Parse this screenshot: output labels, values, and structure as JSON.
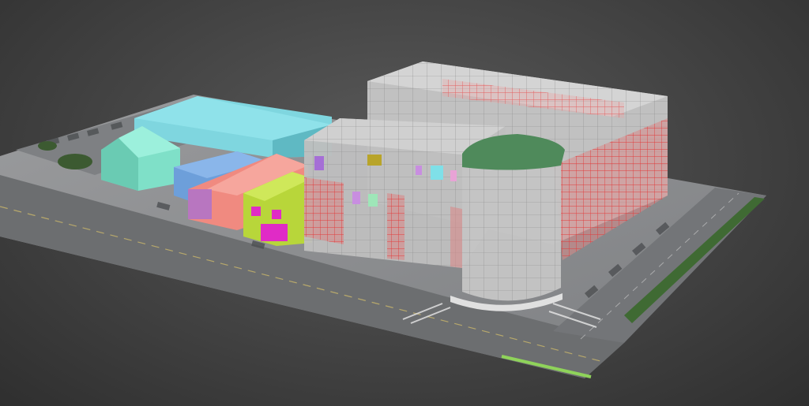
{
  "viewport": {
    "background": "#474747",
    "label": ""
  },
  "scene": {
    "ground": {
      "color": "#8e9092",
      "road_color": "#6c6e70",
      "grass_color": "#3f6a33",
      "accent_line": "#8fd35a"
    },
    "main_building": {
      "glass_color": "#bdbdbd",
      "grid_color": "#e23a3a",
      "canopy_color": "#4f8a5b"
    },
    "neighbors": [
      {
        "name": "long-teal-block",
        "color": "#7fd6df"
      },
      {
        "name": "mint-house",
        "color": "#7fe0c8"
      },
      {
        "name": "blue-block",
        "color": "#6d9fda"
      },
      {
        "name": "salmon-block",
        "color": "#f08a80"
      },
      {
        "name": "lime-block",
        "color": "#b8d63a"
      }
    ],
    "accent_magenta": "#e02bc6"
  }
}
